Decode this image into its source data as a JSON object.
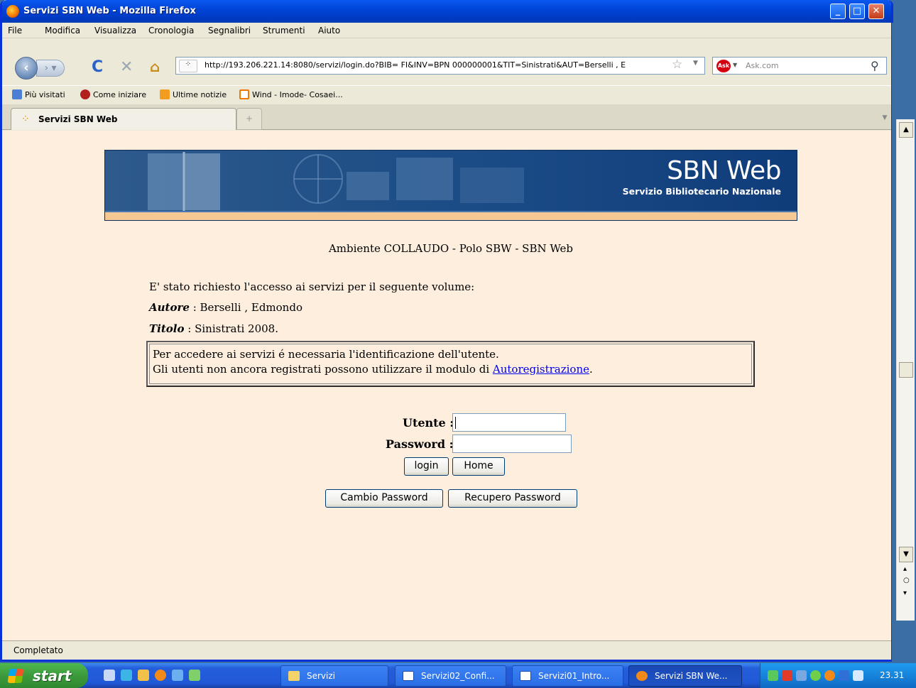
{
  "window": {
    "title": "Servizi SBN Web - Mozilla Firefox"
  },
  "menu": [
    "File",
    "Modifica",
    "Visualizza",
    "Cronologia",
    "Segnalibri",
    "Strumenti",
    "Aiuto"
  ],
  "navbar": {
    "url": "http://193.206.221.14:8080/servizi/login.do?BIB= FI&INV=BPN 000000001&TIT=Sinistrati&AUT=Berselli , E",
    "search_placeholder": "Ask.com"
  },
  "bookmarks": [
    "Più visitati",
    "Come iniziare",
    "Ultime notizie",
    "Wind - Imode- Cosaei..."
  ],
  "tabs": [
    {
      "label": "Servizi SBN Web"
    }
  ],
  "page": {
    "banner_title": "SBN Web",
    "banner_subtitle": "Servizio Bibliotecario Nazionale",
    "environment": "Ambiente COLLAUDO - Polo SBW - SBN Web",
    "request_intro": "E' stato richiesto l'accesso ai servizi per il seguente volume:",
    "author_label": "Autore",
    "author_value": " : Berselli , Edmondo",
    "title_label": "Titolo",
    "title_value": " : Sinistrati 2008.",
    "info_line1": "Per accedere ai servizi é necessaria l'identificazione dell'utente.",
    "info_line2_prefix": "Gli utenti non ancora registrati possono utilizzare il modulo di ",
    "info_link": "Autoregistrazione",
    "info_line2_suffix": ".",
    "user_label": "Utente :",
    "user_value": "",
    "password_label": "Password :",
    "password_value": "",
    "login_button": "login",
    "home_button": "Home",
    "change_password_button": "Cambio Password",
    "recover_password_button": "Recupero Password"
  },
  "status": {
    "text": "Completato"
  },
  "taskbar": {
    "start": "start",
    "tasks": [
      "Servizi",
      "Servizi02_Confi...",
      "Servizi01_Intro...",
      "Servizi SBN We..."
    ],
    "clock": "23.31"
  }
}
